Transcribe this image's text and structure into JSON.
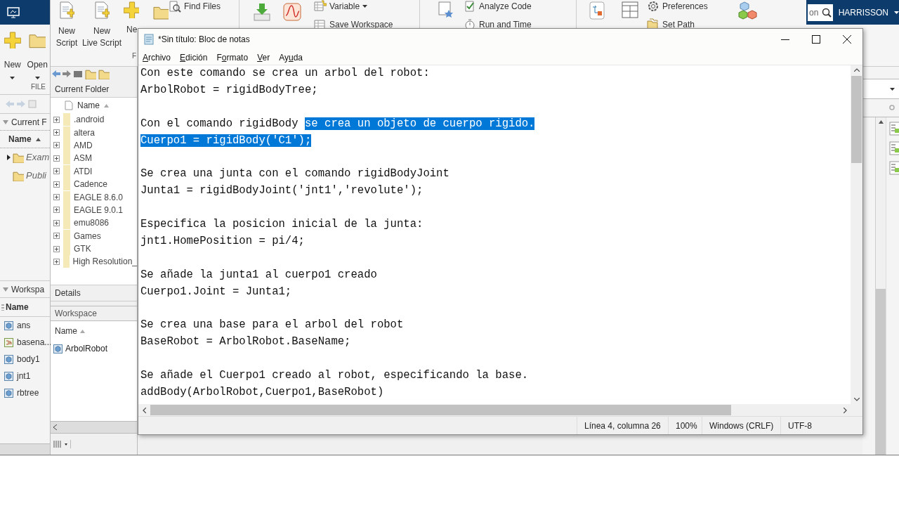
{
  "matlab": {
    "toolstrip": {
      "left_buttons": [
        {
          "label": "New",
          "kind": "plus"
        },
        {
          "label": "Open",
          "kind": "folder"
        }
      ],
      "section_label": "FILE",
      "big_buttons": [
        {
          "label": "New Script",
          "kind": "script"
        },
        {
          "label": "New Live Script",
          "kind": "live"
        },
        {
          "label": "Ne",
          "kind": "plus"
        }
      ],
      "section_label_cut": "F",
      "small_groups": [
        {
          "items": [
            {
              "label": "Find Files",
              "kind": "find"
            }
          ]
        },
        {
          "items": [
            {
              "label": "Variable",
              "kind": "variable",
              "dropdown": true
            },
            {
              "label": "Save Workspace",
              "kind": "save",
              "dropdown": false
            }
          ]
        },
        {
          "items": [
            {
              "label": "Analyze Code",
              "kind": "analyze",
              "dropdown": false
            },
            {
              "label": "Run and Time",
              "kind": "run",
              "dropdown": false
            }
          ]
        },
        {
          "items": [
            {
              "label": "Preferences",
              "kind": "gear",
              "dropdown": false
            },
            {
              "label": "Set Path",
              "kind": "path",
              "dropdown": false
            }
          ]
        }
      ],
      "search_value": "on",
      "user": "HARRISSON"
    },
    "left_panel": {
      "folder_title": "Current F",
      "column": "Name",
      "folder_items": [
        {
          "name": "Exam",
          "expandable": true
        },
        {
          "name": "Publi",
          "expandable": false
        }
      ],
      "workspace_title": "Workspa",
      "workspace_column": "Name",
      "variables": [
        {
          "name": "ans",
          "kind": "object"
        },
        {
          "name": "basena...",
          "kind": "char"
        },
        {
          "name": "body1",
          "kind": "object"
        },
        {
          "name": "jnt1",
          "kind": "object"
        },
        {
          "name": "rbtree",
          "kind": "object"
        }
      ]
    },
    "folder_panel": {
      "title": "Current Folder",
      "column": "Name",
      "folders": [
        ".android",
        "altera",
        "AMD",
        "ASM",
        "ATDI",
        "Cadence",
        "EAGLE 8.6.0",
        "EAGLE 9.0.1",
        "emu8086",
        "Games",
        "GTK",
        "High Resolution_"
      ],
      "details": "Details",
      "workspace_title": "Workspace",
      "workspace_column": "Name",
      "variables": [
        {
          "name": "ArbolRobot",
          "kind": "object"
        }
      ]
    }
  },
  "notepad": {
    "title": "*Sin título: Bloc de notas",
    "menu": [
      {
        "key": "A",
        "after": "rchivo"
      },
      {
        "key": "E",
        "after": "dición"
      },
      {
        "before": "F",
        "key": "o",
        "after": "rmato"
      },
      {
        "key": "V",
        "after": "er"
      },
      {
        "before": "Ay",
        "key": "u",
        "after": "da"
      }
    ],
    "lines": [
      {
        "kind": "text",
        "segments": [
          {
            "text": "Con este comando se crea un arbol del robot:",
            "selected": false
          }
        ]
      },
      {
        "kind": "text",
        "segments": [
          {
            "text": "ArbolRobot = rigidBodyTree;",
            "selected": false
          }
        ]
      },
      {
        "kind": "blank"
      },
      {
        "kind": "text",
        "segments": [
          {
            "text": "Con el comando rigidBody ",
            "selected": false
          },
          {
            "text": "se crea un objeto de cuerpo rigido.",
            "selected": true
          }
        ]
      },
      {
        "kind": "text",
        "segments": [
          {
            "text": "Cuerpo1 = rigidBody('C1');",
            "selected": true
          }
        ]
      },
      {
        "kind": "blank"
      },
      {
        "kind": "text",
        "segments": [
          {
            "text": "Se crea una junta con el comando rigidBodyJoint",
            "selected": false
          }
        ]
      },
      {
        "kind": "text",
        "segments": [
          {
            "text": "Junta1 = rigidBodyJoint('jnt1','revolute');",
            "selected": false
          }
        ]
      },
      {
        "kind": "blank"
      },
      {
        "kind": "text",
        "segments": [
          {
            "text": "Especifica la posicion inicial de la junta:",
            "selected": false
          }
        ]
      },
      {
        "kind": "text",
        "segments": [
          {
            "text": "jnt1.HomePosition = pi/4;",
            "selected": false
          }
        ]
      },
      {
        "kind": "blank"
      },
      {
        "kind": "text",
        "segments": [
          {
            "text": "Se añade la junta1 al cuerpo1 creado",
            "selected": false
          }
        ]
      },
      {
        "kind": "text",
        "segments": [
          {
            "text": "Cuerpo1.Joint = Junta1;",
            "selected": false
          }
        ]
      },
      {
        "kind": "blank"
      },
      {
        "kind": "text",
        "segments": [
          {
            "text": "Se crea una base para el arbol del robot",
            "selected": false
          }
        ]
      },
      {
        "kind": "text",
        "segments": [
          {
            "text": "BaseRobot = ArbolRobot.BaseName;",
            "selected": false
          }
        ]
      },
      {
        "kind": "blank"
      },
      {
        "kind": "text",
        "segments": [
          {
            "text": "Se añade el Cuerpo1 creado al robot, especificando la base.",
            "selected": false
          }
        ]
      },
      {
        "kind": "text",
        "segments": [
          {
            "text": "addBody(ArbolRobot,Cuerpo1,BaseRobot)",
            "selected": false
          }
        ]
      }
    ],
    "status": [
      "Línea 4, columna 26",
      "100%",
      "Windows (CRLF)",
      "UTF-8"
    ]
  }
}
